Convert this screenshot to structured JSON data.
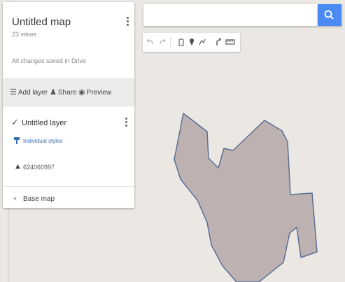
{
  "map": {
    "title": "Untitled map",
    "views": "23 views",
    "save_status": "All changes saved in Drive"
  },
  "actions": {
    "add_layer": "Add layer",
    "share": "Share",
    "preview": "Preview"
  },
  "layer": {
    "title": "Untitled layer",
    "styles_link": "Individual styles",
    "feature_label": "624060997"
  },
  "base_map": {
    "label": "Base map"
  },
  "search": {
    "placeholder": "",
    "value": ""
  },
  "toolbar": {
    "tools": [
      "undo-icon",
      "redo-icon",
      "hand-icon",
      "marker-icon",
      "draw-line-icon",
      "directions-icon",
      "ruler-icon"
    ]
  },
  "colors": {
    "accent": "#4a8af4",
    "polygon_fill": "#bdb1b1",
    "map_background": "#ebe8e4",
    "link": "#3b6fb6"
  }
}
